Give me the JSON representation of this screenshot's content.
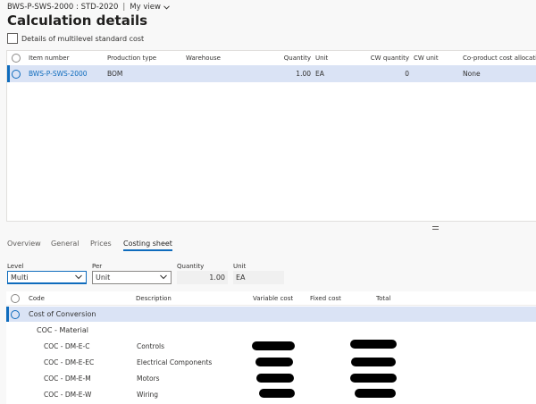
{
  "breadcrumb": {
    "path": "BWS-P-SWS-2000 : STD-2020",
    "view": "My view"
  },
  "title": "Calculation details",
  "multilevel_label": "Details of multilevel standard cost",
  "grid1": {
    "headers": [
      "Item number",
      "Production type",
      "Warehouse",
      "Quantity",
      "Unit",
      "CW quantity",
      "CW unit",
      "Co-product cost allocation"
    ],
    "row": {
      "item_number": "BWS-P-SWS-2000",
      "production_type": "BOM",
      "warehouse": "",
      "quantity": "1.00",
      "unit": "EA",
      "cw_quantity": "0",
      "cw_unit": "",
      "allocation": "None"
    }
  },
  "tabs": [
    "Overview",
    "General",
    "Prices",
    "Costing sheet"
  ],
  "active_tab": "Costing sheet",
  "filters": {
    "level_label": "Level",
    "level_value": "Multi",
    "per_label": "Per",
    "per_value": "Unit",
    "quantity_label": "Quantity",
    "quantity_value": "1.00",
    "unit_label": "Unit",
    "unit_value": "EA"
  },
  "grid2": {
    "headers": [
      "Code",
      "Description",
      "Variable cost",
      "Fixed cost",
      "Total"
    ],
    "group": "Cost of Conversion",
    "subgroup": "COC - Material",
    "rows": [
      {
        "code": "COC - DM-E-C",
        "description": "Controls"
      },
      {
        "code": "COC - DM-E-EC",
        "description": "Electrical Components"
      },
      {
        "code": "COC - DM-E-M",
        "description": "Motors"
      },
      {
        "code": "COC - DM-E-W",
        "description": "Wiring"
      }
    ]
  },
  "colors": {
    "accent": "#0f6cbd",
    "selected_row": "#dae3f5"
  },
  "icons": [
    "chevron-down-icon",
    "radio-icon",
    "checkbox-icon",
    "splitter-icon"
  ]
}
